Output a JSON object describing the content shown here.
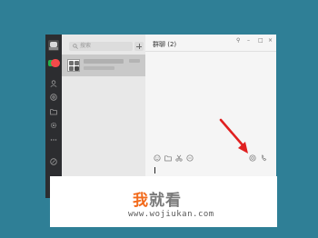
{
  "sidebar": {
    "icons": [
      "avatar",
      "chat-icon",
      "contacts-icon",
      "moments-icon",
      "folder-icon",
      "gear-icon",
      "more-icon",
      "phone-icon"
    ]
  },
  "chat_list": {
    "search_placeholder": "搜索",
    "items": [
      {
        "name": "",
        "time": "",
        "preview": ""
      }
    ]
  },
  "chat": {
    "title": "群聊 (2)",
    "window_controls": [
      "⚲",
      "–",
      "□",
      "×"
    ],
    "toolbar_icons": [
      "emoji-icon",
      "folder-icon",
      "scissors-icon",
      "chat-history-icon",
      "video-call-icon",
      "phone-call-icon"
    ]
  },
  "annotation": {
    "arrow_color": "#e02020"
  },
  "watermark": {
    "title_first": "我",
    "title_rest": "就看",
    "url": "www.wojiukan.com",
    "accent": "#f26a1b"
  }
}
